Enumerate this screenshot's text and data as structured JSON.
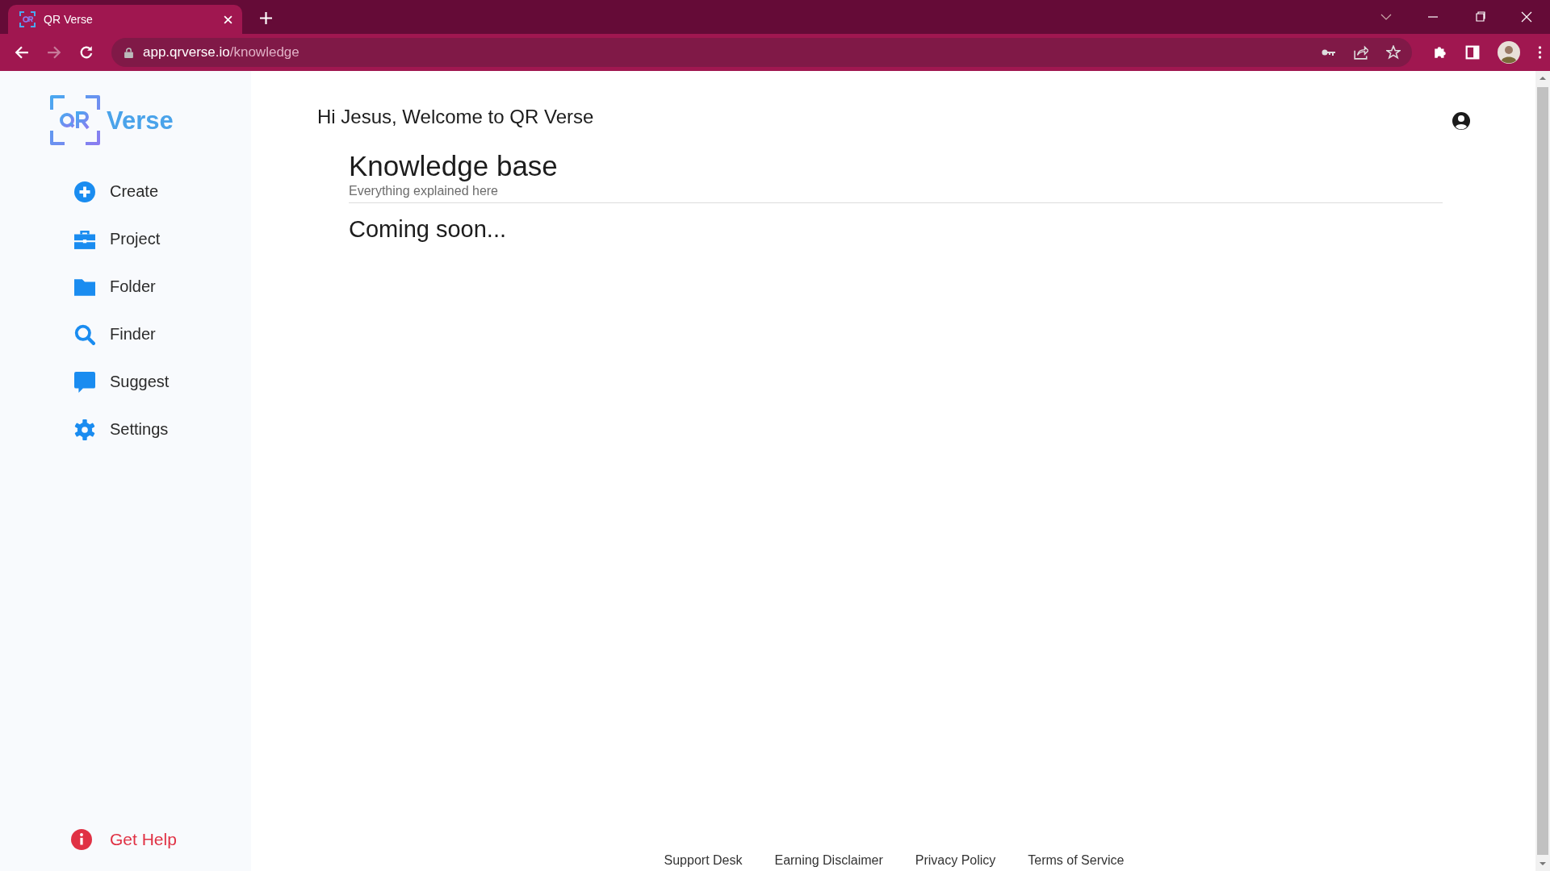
{
  "browser": {
    "tab_title": "QR Verse",
    "url_host": "app.qrverse.io",
    "url_path": "/knowledge"
  },
  "sidebar": {
    "logo_text": "Verse",
    "items": [
      {
        "label": "Create"
      },
      {
        "label": "Project"
      },
      {
        "label": "Folder"
      },
      {
        "label": "Finder"
      },
      {
        "label": "Suggest"
      },
      {
        "label": "Settings"
      }
    ],
    "help": "Get Help"
  },
  "greeting": "Hi Jesus, Welcome to QR Verse",
  "page": {
    "title": "Knowledge base",
    "subtitle": "Everything explained here",
    "body": "Coming soon..."
  },
  "footer": [
    "Support Desk",
    "Earning Disclaimer",
    "Privacy Policy",
    "Terms of Service"
  ]
}
